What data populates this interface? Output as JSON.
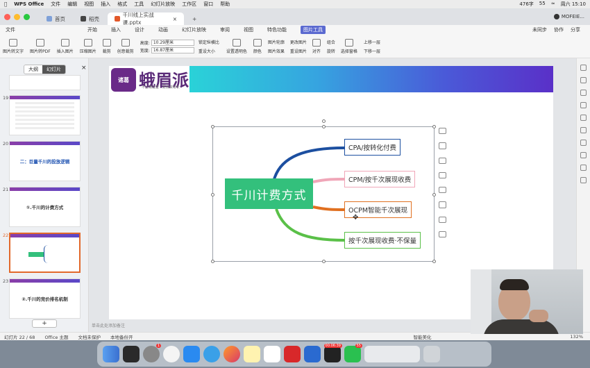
{
  "mac_menu": {
    "app": "WPS Office",
    "items": [
      "文件",
      "编辑",
      "视图",
      "插入",
      "格式",
      "工具",
      "幻灯片放映",
      "工作区",
      "窗口",
      "帮助"
    ],
    "status_words": "476字",
    "battery": "55",
    "clock": "周六 15:10"
  },
  "tabs": [
    {
      "label": "首页"
    },
    {
      "label": "稻壳"
    },
    {
      "label": "千川线上实战课.pptx"
    }
  ],
  "new_tab": "+",
  "user": "MOFEIE...",
  "menubar": {
    "file": "文件",
    "items": [
      "开始",
      "插入",
      "设计",
      "动画",
      "幻灯片放映",
      "审阅",
      "视图",
      "特色功能",
      "图片工具"
    ],
    "unsync": "未同步",
    "collab": "协作",
    "share": "分享"
  },
  "ribbon": {
    "buttons": [
      "图片转文字",
      "图片转PDF",
      "插入图片",
      "压缩图片",
      "裁剪",
      "创意裁剪"
    ],
    "height_label": "高度:",
    "height_value": "10.29厘米",
    "width_label": "宽度:",
    "width_value": "16.87厘米",
    "lock_ratio": "锁定纵横比",
    "reset_size": "重设大小",
    "buttons2": [
      "设置透明色",
      "颜色",
      "图片轮廓",
      "图片效果",
      "更改图片",
      "重设图片",
      "对齐",
      "组合",
      "旋转",
      "选择窗格",
      "上移一层",
      "下移一层"
    ]
  },
  "panel": {
    "tab_outline": "大纲",
    "tab_slides": "幻灯片",
    "close": "×",
    "add": "+"
  },
  "thumbs": [
    {
      "num": "19",
      "title": ""
    },
    {
      "num": "20",
      "title": "二：巨量千川的投放逻辑"
    },
    {
      "num": "21",
      "title": "①.千川的计费方式"
    },
    {
      "num": "22",
      "title": ""
    },
    {
      "num": "23",
      "title": "②.千川的竞价排名机制"
    }
  ],
  "slide": {
    "logo_text": "诸葛",
    "brand": "蛾眉派",
    "slogan": "不止懂运营 · 更会做增长",
    "root": "千川计费方式",
    "branches": [
      "CPA/按转化付费",
      "CPM/按千次展现收费",
      "OCPM智能千次展现",
      "按千次展现收费·不保量"
    ],
    "branch_colors": [
      "#1c4fa0",
      "#f0a6b8",
      "#e07020",
      "#5ac048"
    ]
  },
  "notes": "单击此处添加备注",
  "status": {
    "slide": "幻灯片 22 / 68",
    "theme": "Office 主题",
    "protect": "文档未保护",
    "backup": "本地备份开",
    "beautify": "智能美化",
    "zoom": "132%"
  },
  "dock_badges": {
    "settings": "1",
    "recorder": "00:06:39",
    "wechat": "55"
  }
}
